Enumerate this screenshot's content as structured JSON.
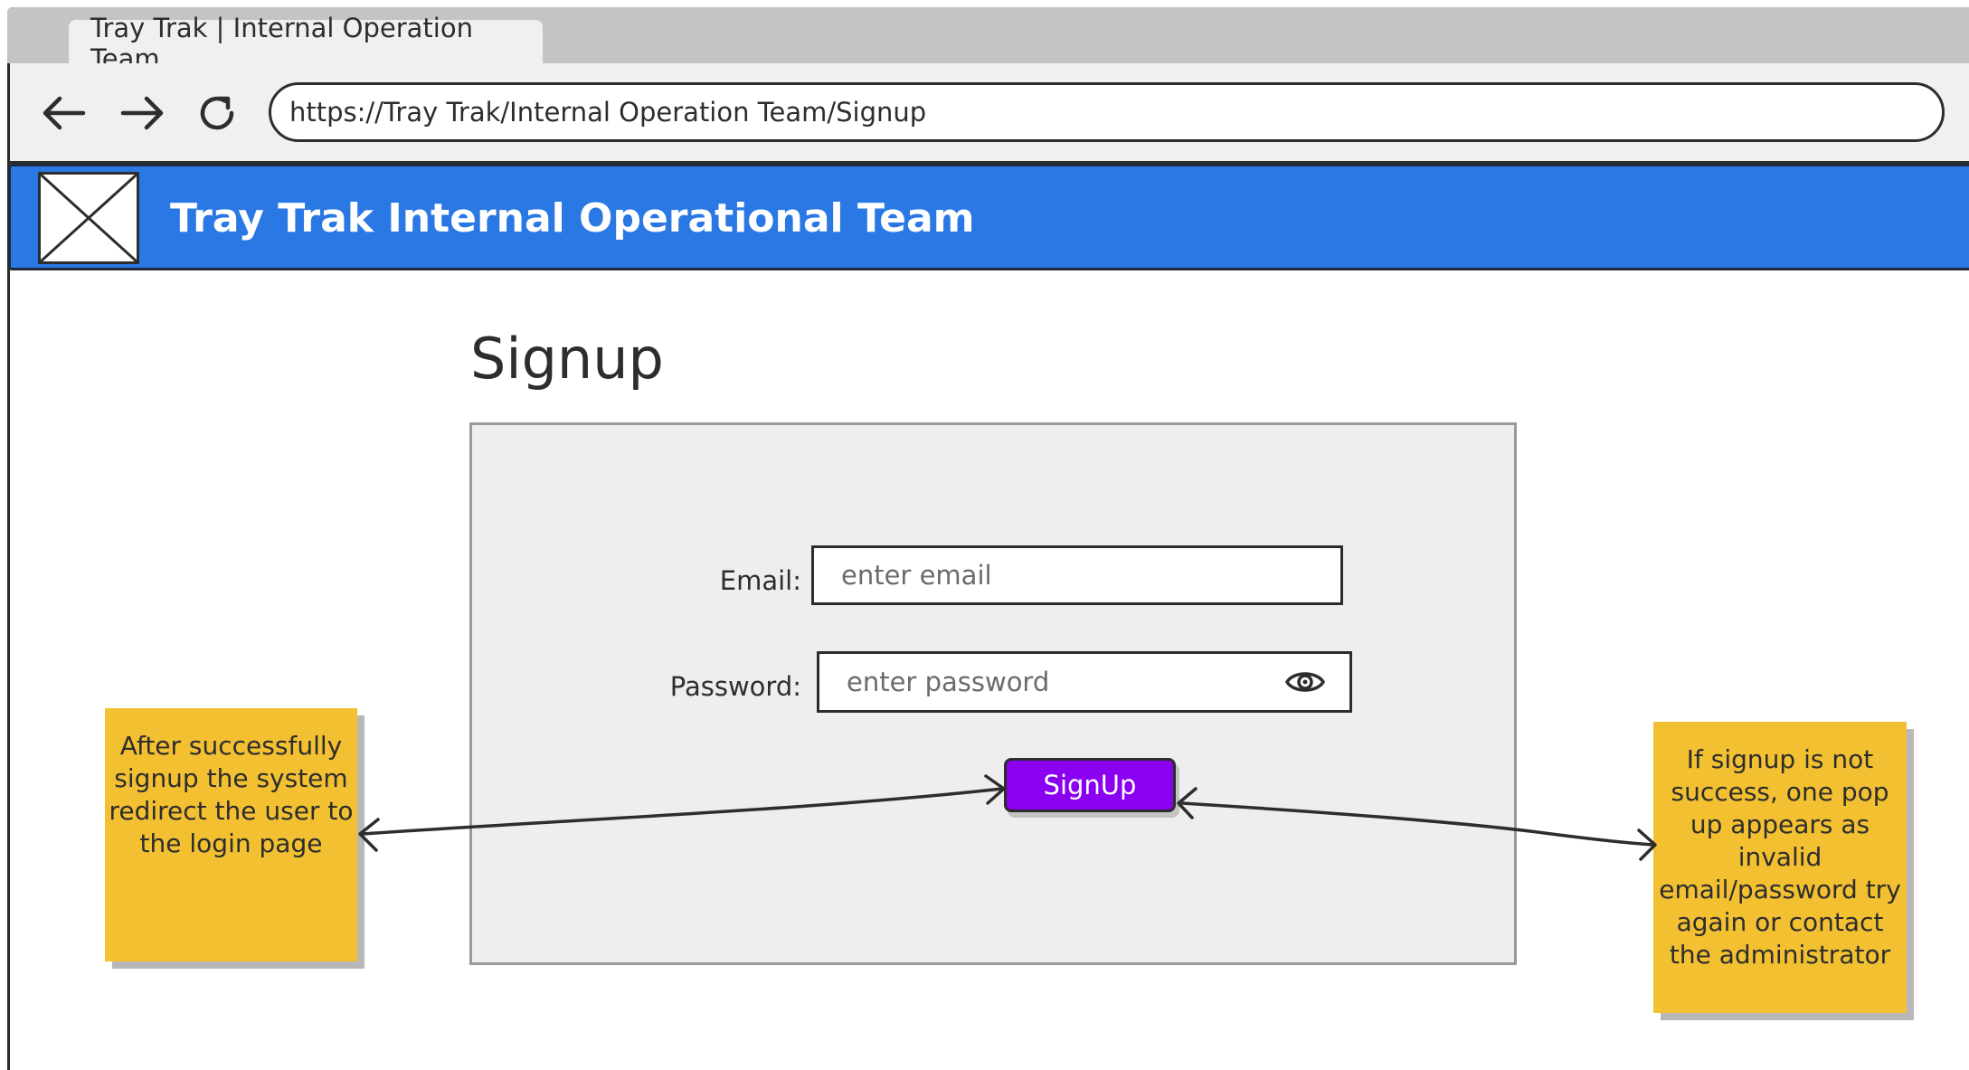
{
  "browser": {
    "tab_title": "Tray Trak | Internal Operation Team",
    "url": "https://Tray Trak/Internal Operation Team/Signup"
  },
  "header": {
    "title": "Tray Trak Internal Operational Team"
  },
  "page": {
    "title": "Signup"
  },
  "form": {
    "email_label": "Email:",
    "email_placeholder": "enter email",
    "email_value": "",
    "password_label": "Password:",
    "password_placeholder": "enter password",
    "password_value": "",
    "submit_label": "SignUp"
  },
  "notes": {
    "success": "After successfully signup the system redirect the user to the login page",
    "failure": "If signup is not success, one pop up appears as invalid email/password try again or contact the administrator"
  },
  "icons": {
    "back": "arrow-left-icon",
    "forward": "arrow-right-icon",
    "reload": "reload-icon",
    "logo": "image-placeholder-icon",
    "password_toggle": "eye-icon"
  },
  "colors": {
    "header_bg": "#2a78e4",
    "button_bg": "#8a00f0",
    "sticky_note": "#f2c031",
    "panel_bg": "#eeeeee"
  }
}
